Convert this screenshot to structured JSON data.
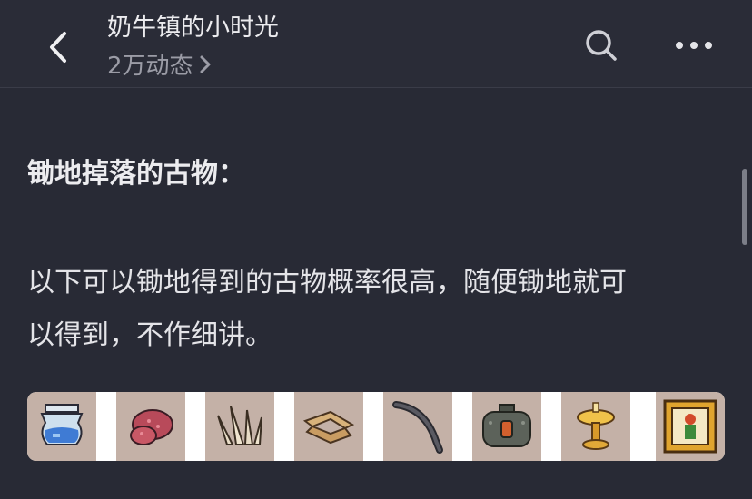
{
  "header": {
    "title": "奶牛镇的小时光",
    "subtitle": "2万动态",
    "back_icon": "chevron-left-icon",
    "search_icon": "search-icon",
    "more_icon": "more-dots-icon"
  },
  "post": {
    "heading": "锄地掉落的古物：",
    "paragraph_line1": "以下可以锄地得到的古物概率很高，随便锄地就可",
    "paragraph_line2": "以得到，不作细讲。"
  },
  "artifacts": [
    {
      "name": "glass-vase-artifact-icon"
    },
    {
      "name": "red-ore-artifact-icon"
    },
    {
      "name": "bone-claws-artifact-icon"
    },
    {
      "name": "boomerang-artifact-icon"
    },
    {
      "name": "curved-bow-artifact-icon"
    },
    {
      "name": "metal-pot-artifact-icon"
    },
    {
      "name": "golden-lamp-artifact-icon"
    },
    {
      "name": "framed-portrait-artifact-icon"
    }
  ],
  "colors": {
    "background": "#282a35",
    "tile_background": "#c4b1a7",
    "text_primary": "#ececef",
    "text_secondary": "#9b9ca6"
  }
}
